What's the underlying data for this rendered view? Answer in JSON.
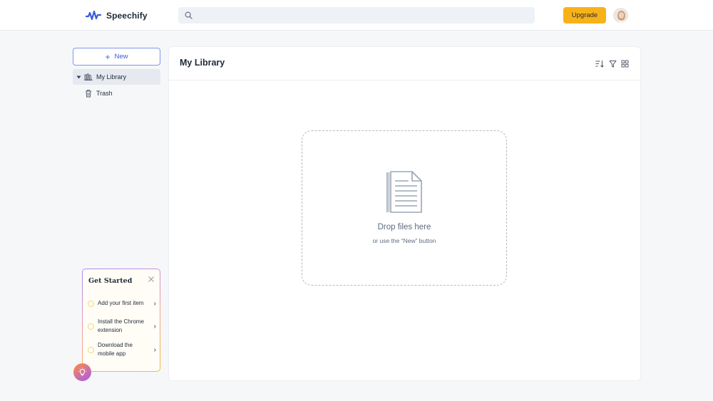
{
  "app": {
    "name": "Speechify",
    "accent": "#3b5bdb"
  },
  "header": {
    "search": {
      "placeholder": "",
      "value": "",
      "icon": "search-icon"
    },
    "upgrade_label": "Upgrade",
    "upgrade_color": "#f8b219",
    "avatar": "avatar"
  },
  "sidebar": {
    "new_label": "New",
    "items": [
      {
        "label": "My Library",
        "icon": "library-icon",
        "active": true
      },
      {
        "label": "Trash",
        "icon": "trash-icon",
        "active": false
      }
    ]
  },
  "main": {
    "title": "My Library",
    "tools": [
      "sort-icon",
      "filter-icon",
      "grid-view-icon"
    ],
    "dropzone": {
      "title": "Drop files here",
      "subtitle": "or use the “New” button",
      "icon": "document-icon"
    }
  },
  "get_started": {
    "title": "Get Started",
    "items": [
      {
        "label": "Add your first item"
      },
      {
        "label": "Install the Chrome extension"
      },
      {
        "label": "Download the mobile app"
      }
    ]
  }
}
